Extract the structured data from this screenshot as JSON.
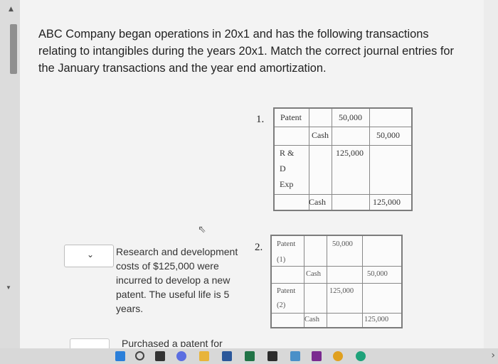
{
  "question": {
    "text": "ABC Company began operations in 20x1 and has the following transactions relating to intangibles during the years 20x1. Match the correct journal entries for the January transactions and the year end amortization."
  },
  "entries": [
    {
      "number": "1.",
      "cells": {
        "r1_account": "Patent",
        "r1_debit": "50,000",
        "r2_account": "Cash",
        "r2_credit": "50,000",
        "r3_account_l1": "R &",
        "r3_account_l2": "D",
        "r3_account_l3": "Exp",
        "r3_debit": "125,000",
        "r4_account": "Cash",
        "r4_credit": "125,000"
      }
    },
    {
      "number": "2.",
      "cells": {
        "r1_account": "Patent",
        "r1_sub": "(1)",
        "r1_debit": "50,000",
        "r2_account": "Cash",
        "r2_credit": "50,000",
        "r3_account": "Patent",
        "r3_sub": "(2)",
        "r3_debit": "125,000",
        "r4_account": "Cash",
        "r4_credit": "125,000"
      }
    }
  ],
  "match_items": [
    {
      "text": "Research and development costs of $125,000 were incurred to develop a new patent. The useful life is 5 years.",
      "chevron_icon": "chevron-down-icon"
    },
    {
      "text": "Purchased a patent for"
    }
  ],
  "taskbar": {
    "icons": [
      "windows-icon",
      "search-icon",
      "task-view-icon",
      "chat-icon",
      "folder-icon",
      "word-icon",
      "excel-icon",
      "app-icon",
      "store-icon",
      "onenote-icon",
      "chrome-icon",
      "edge-icon"
    ]
  }
}
